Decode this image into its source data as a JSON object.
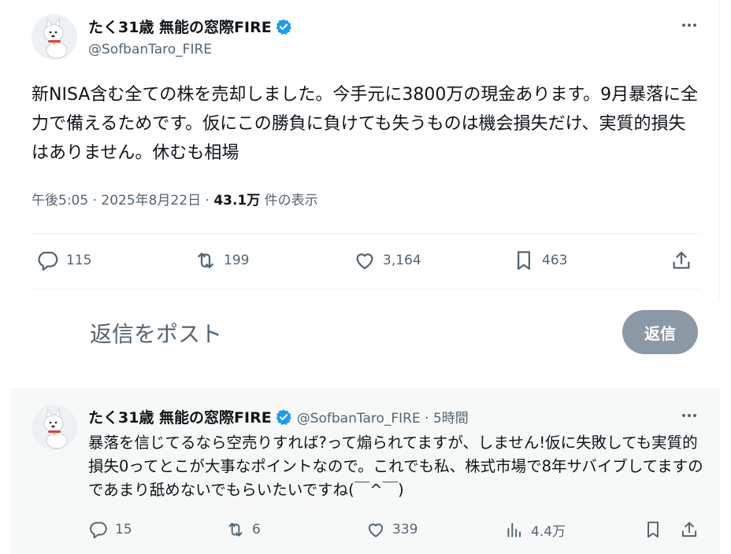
{
  "post": {
    "display_name": "たく31歳 無能の窓際FIRE",
    "handle": "@SofbanTaro_FIRE",
    "text": "新NISA含む全ての株を売却しました。今手元に3800万の現金あります。9月暴落に全力で備えるためです。仮にこの勝負に負けても失うものは機会損失だけ、実質的損失はありません。休むも相場",
    "time": "午後5:05 · 2025年8月22日 · ",
    "views_count": "43.1万",
    "views_suffix": " 件の表示",
    "actions": {
      "replies": "115",
      "retweets": "199",
      "likes": "3,164",
      "bookmarks": "463"
    }
  },
  "reply_box": {
    "placeholder": "返信をポスト",
    "button_label": "返信"
  },
  "reply": {
    "display_name": "たく31歳 無能の窓際FIRE",
    "handle_time": "@SofbanTaro_FIRE · 5時間",
    "text": "暴落を信じてるなら空売りすれば?って煽られてますが、しません!仮に失敗しても実質的損失0ってとこが大事なポイントなので。これでも私、株式市場で8年サバイブしてますのであまり舐めないでもらいたいですね(￣^￣)",
    "actions": {
      "replies": "15",
      "retweets": "6",
      "likes": "339",
      "views": "4.4万"
    }
  },
  "colors": {
    "verified_blue": "#1d9bf0",
    "text_primary": "#0f1419",
    "text_secondary": "#536471",
    "reply_button_bg": "#8b98a5"
  },
  "icons": {
    "reply": "comment-icon",
    "retweet": "retweet-icon",
    "like": "heart-icon",
    "bookmark": "bookmark-icon",
    "share": "share-icon",
    "views": "bar-chart-icon",
    "verified": "verified-badge-icon",
    "more": "more-horizontal-icon"
  }
}
